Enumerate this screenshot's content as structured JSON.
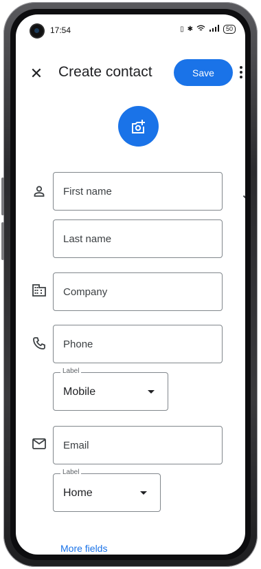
{
  "status_bar": {
    "time": "17:54",
    "battery": "50"
  },
  "appbar": {
    "close_icon": "close-icon",
    "title": "Create contact",
    "save_label": "Save",
    "more_icon": "more-vert-icon"
  },
  "photo": {
    "icon": "add-photo-icon"
  },
  "name": {
    "icon": "person-icon",
    "first_placeholder": "First name",
    "last_placeholder": "Last name",
    "expand_icon": "chevron-down-icon"
  },
  "company": {
    "icon": "business-icon",
    "placeholder": "Company"
  },
  "phone": {
    "icon": "phone-icon",
    "placeholder": "Phone",
    "label_legend": "Label",
    "label_value": "Mobile"
  },
  "email": {
    "icon": "email-icon",
    "placeholder": "Email",
    "label_legend": "Label",
    "label_value": "Home"
  },
  "more_fields": "More fields",
  "colors": {
    "accent": "#1a73e8",
    "text": "#202124",
    "outline": "#80868b"
  }
}
